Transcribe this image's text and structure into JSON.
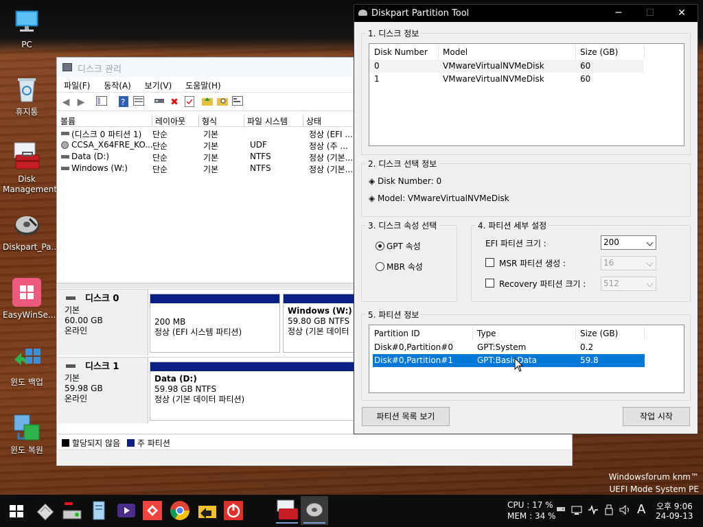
{
  "desktop": {
    "icons": [
      {
        "label": "PC"
      },
      {
        "label": "휴지통"
      },
      {
        "label": "Disk Management"
      },
      {
        "label": "Diskpart_Pa..."
      },
      {
        "label": "EasyWinSe..."
      },
      {
        "label": "윈도 백업"
      },
      {
        "label": "윈도 복원"
      }
    ],
    "watermark": {
      "line1": "Windowsforum knm™",
      "line2": "UEFI Mode System PE"
    }
  },
  "disk_management": {
    "title": "디스크 관리",
    "menu": [
      "파일(F)",
      "동작(A)",
      "보기(V)",
      "도움말(H)"
    ],
    "columns": [
      "볼륨",
      "레이아웃",
      "형식",
      "파일 시스템",
      "상태"
    ],
    "volumes": [
      {
        "name": "(디스크 0 파티션 1)",
        "layout": "단순",
        "type": "기본",
        "fs": "",
        "status": "정상 (EFI ..."
      },
      {
        "name": "CCSA_X64FRE_KO...",
        "layout": "단순",
        "type": "기본",
        "fs": "UDF",
        "status": "정상 (주 ..."
      },
      {
        "name": "Data (D:)",
        "layout": "단순",
        "type": "기본",
        "fs": "NTFS",
        "status": "정상 (기본..."
      },
      {
        "name": "Windows (W:)",
        "layout": "단순",
        "type": "기본",
        "fs": "NTFS",
        "status": "정상 (기본..."
      }
    ],
    "disks": [
      {
        "name": "디스크 0",
        "kind": "기본",
        "size": "60.00 GB",
        "state": "온라인",
        "partitions": [
          {
            "title": "",
            "size": "200 MB",
            "status": "정상 (EFI 시스템 파티션)"
          },
          {
            "title": "Windows  (W:)",
            "size": "59.80 GB NTFS",
            "status": "정상 (기본 데이터"
          }
        ]
      },
      {
        "name": "디스크 1",
        "kind": "기본",
        "size": "59.98 GB",
        "state": "온라인",
        "partitions": [
          {
            "title": "Data  (D:)",
            "size": "59.98 GB NTFS",
            "status": "정상 (기본 데이터 파티션)"
          }
        ]
      }
    ],
    "legend": {
      "unallocated": "할당되지 않음",
      "primary": "주 파티션"
    },
    "colors": {
      "primary": "#0b1f86",
      "unallocated": "#000000"
    }
  },
  "diskpart": {
    "title": "Diskpart Partition Tool",
    "window_controls": {
      "minimize": "─",
      "maximize": "☐",
      "close": "✕"
    },
    "sec1": {
      "title": "1. 디스크 정보",
      "columns": [
        "Disk Number",
        "Model",
        "Size (GB)"
      ],
      "rows": [
        {
          "num": "0",
          "model": "VMwareVirtualNVMeDisk",
          "size": "60"
        },
        {
          "num": "1",
          "model": "VMwareVirtualNVMeDisk",
          "size": "60"
        }
      ]
    },
    "sec2": {
      "title": "2. 디스크 선택 정보",
      "disk_number": "◈ Disk Number: 0",
      "model": "◈ Model: VMwareVirtualNVMeDisk"
    },
    "sec3": {
      "title": "3. 디스크 속성 선택",
      "gpt": "GPT 속성",
      "mbr": "MBR 속성",
      "selected": "gpt"
    },
    "sec4": {
      "title": "4. 파티션 세부 설정",
      "efi_label": "EFI 파티션 크기 :",
      "efi_value": "200",
      "msr_label": "MSR 파티션 생성 :",
      "msr_value": "16",
      "recovery_label": "Recovery 파티션 크기 :",
      "recovery_value": "512"
    },
    "sec5": {
      "title": "5. 파티션 정보",
      "columns": [
        "Partition ID",
        "Type",
        "Size (GB)"
      ],
      "rows": [
        {
          "id": "Disk#0,Partition#0",
          "type": "GPT:System",
          "size": "0.2"
        },
        {
          "id": "Disk#0,Partition#1",
          "type": "GPT:BasicData",
          "size": "59.8"
        }
      ],
      "selected_index": 1
    },
    "buttons": {
      "list": "파티션 목록 보기",
      "start": "작업 시작"
    },
    "colors": {
      "selection": "#0078d7"
    }
  },
  "taskbar": {
    "cpu": "CPU : 17 %",
    "mem": "MEM : 34 %",
    "ime": "A",
    "time": "오후 9:06",
    "date": "24-09-13"
  }
}
